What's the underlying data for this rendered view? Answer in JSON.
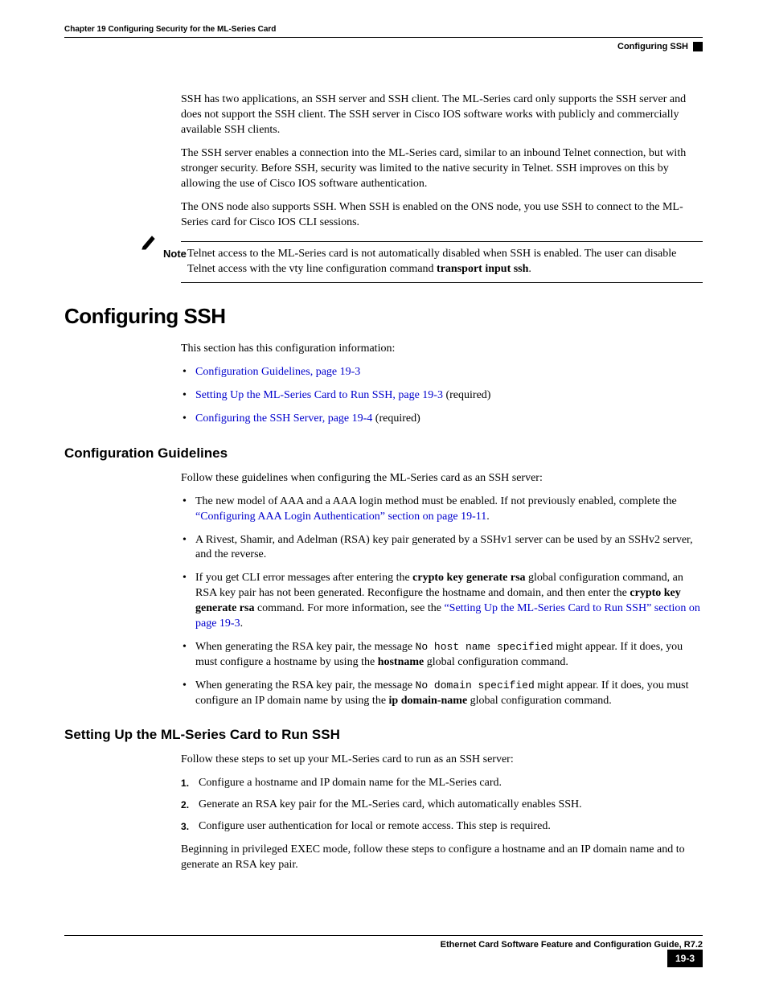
{
  "header": {
    "chapter": "Chapter 19      Configuring Security for the ML-Series Card",
    "section": "Configuring SSH"
  },
  "intro": {
    "p1": "SSH has two applications, an SSH server and SSH client. The ML-Series card only supports the SSH server and does not support the SSH client. The SSH server in Cisco IOS software works with publicly and commercially available SSH clients.",
    "p2": "The SSH server enables a connection into the ML-Series card, similar to an inbound Telnet connection, but with stronger security. Before SSH, security was limited to the native security in Telnet. SSH improves on this by allowing the use of Cisco IOS software authentication.",
    "p3": "The ONS node also supports SSH. When SSH is enabled on the ONS node, you use SSH to connect to the ML-Series card for Cisco IOS CLI sessions."
  },
  "note": {
    "label": "Note",
    "text_a": "Telnet access to the ML-Series card is not automatically disabled when SSH is enabled. The user can disable Telnet access with the vty line configuration command ",
    "text_b": "transport input ssh",
    "text_c": "."
  },
  "h1": "Configuring SSH",
  "sec_intro": "This section has this configuration information:",
  "toc": {
    "i1": "Configuration Guidelines, page 19-3",
    "i2": "Setting Up the ML-Series Card to Run SSH, page 19-3",
    "i2_suffix": " (required)",
    "i3": "Configuring the SSH Server, page 19-4",
    "i3_suffix": " (required)"
  },
  "h2a": "Configuration Guidelines",
  "guidelines_intro": "Follow these guidelines when configuring the ML-Series card as an SSH server:",
  "g": {
    "b1a": "The new model of AAA and a AAA login method must be enabled. If not previously enabled, complete the ",
    "b1_link": "“Configuring AAA Login Authentication” section on page 19-11",
    "b1b": ".",
    "b2": "A Rivest, Shamir, and Adelman (RSA) key pair generated by a SSHv1 server can be used by an SSHv2 server, and the reverse.",
    "b3a": "If you get CLI error messages after entering the ",
    "b3_bold1": "crypto key generate rsa",
    "b3b": " global configuration command, an RSA key pair has not been generated. Reconfigure the hostname and domain, and then enter the ",
    "b3_bold2": "crypto key generate rsa",
    "b3c": " command. For more information, see the ",
    "b3_link": "“Setting Up the ML-Series Card to Run SSH” section on page 19-3",
    "b3d": ".",
    "b4a": "When generating the RSA key pair, the message ",
    "b4_code": "No host name specified",
    "b4b": " might appear. If it does, you must configure a hostname by using the ",
    "b4_bold": "hostname",
    "b4c": " global configuration command.",
    "b5a": "When generating the RSA key pair, the message ",
    "b5_code": "No domain specified",
    "b5b": " might appear. If it does, you must configure an IP domain name by using the ",
    "b5_bold": "ip domain-name",
    "b5c": " global configuration command."
  },
  "h2b": "Setting Up the ML-Series Card to Run SSH",
  "setup_intro": "Follow these steps to set up your ML-Series card to run as an SSH server:",
  "steps": {
    "s1": "Configure a hostname and IP domain name for the ML-Series card.",
    "s2": "Generate an RSA key pair for the ML-Series card, which automatically enables SSH.",
    "s3": "Configure user authentication for local or remote access. This step is required."
  },
  "setup_outro": "Beginning in privileged EXEC mode, follow these steps to configure a hostname and an IP domain name and to generate an RSA key pair.",
  "footer": {
    "title": "Ethernet Card Software Feature and Configuration Guide, R7.2",
    "page": "19-3"
  }
}
